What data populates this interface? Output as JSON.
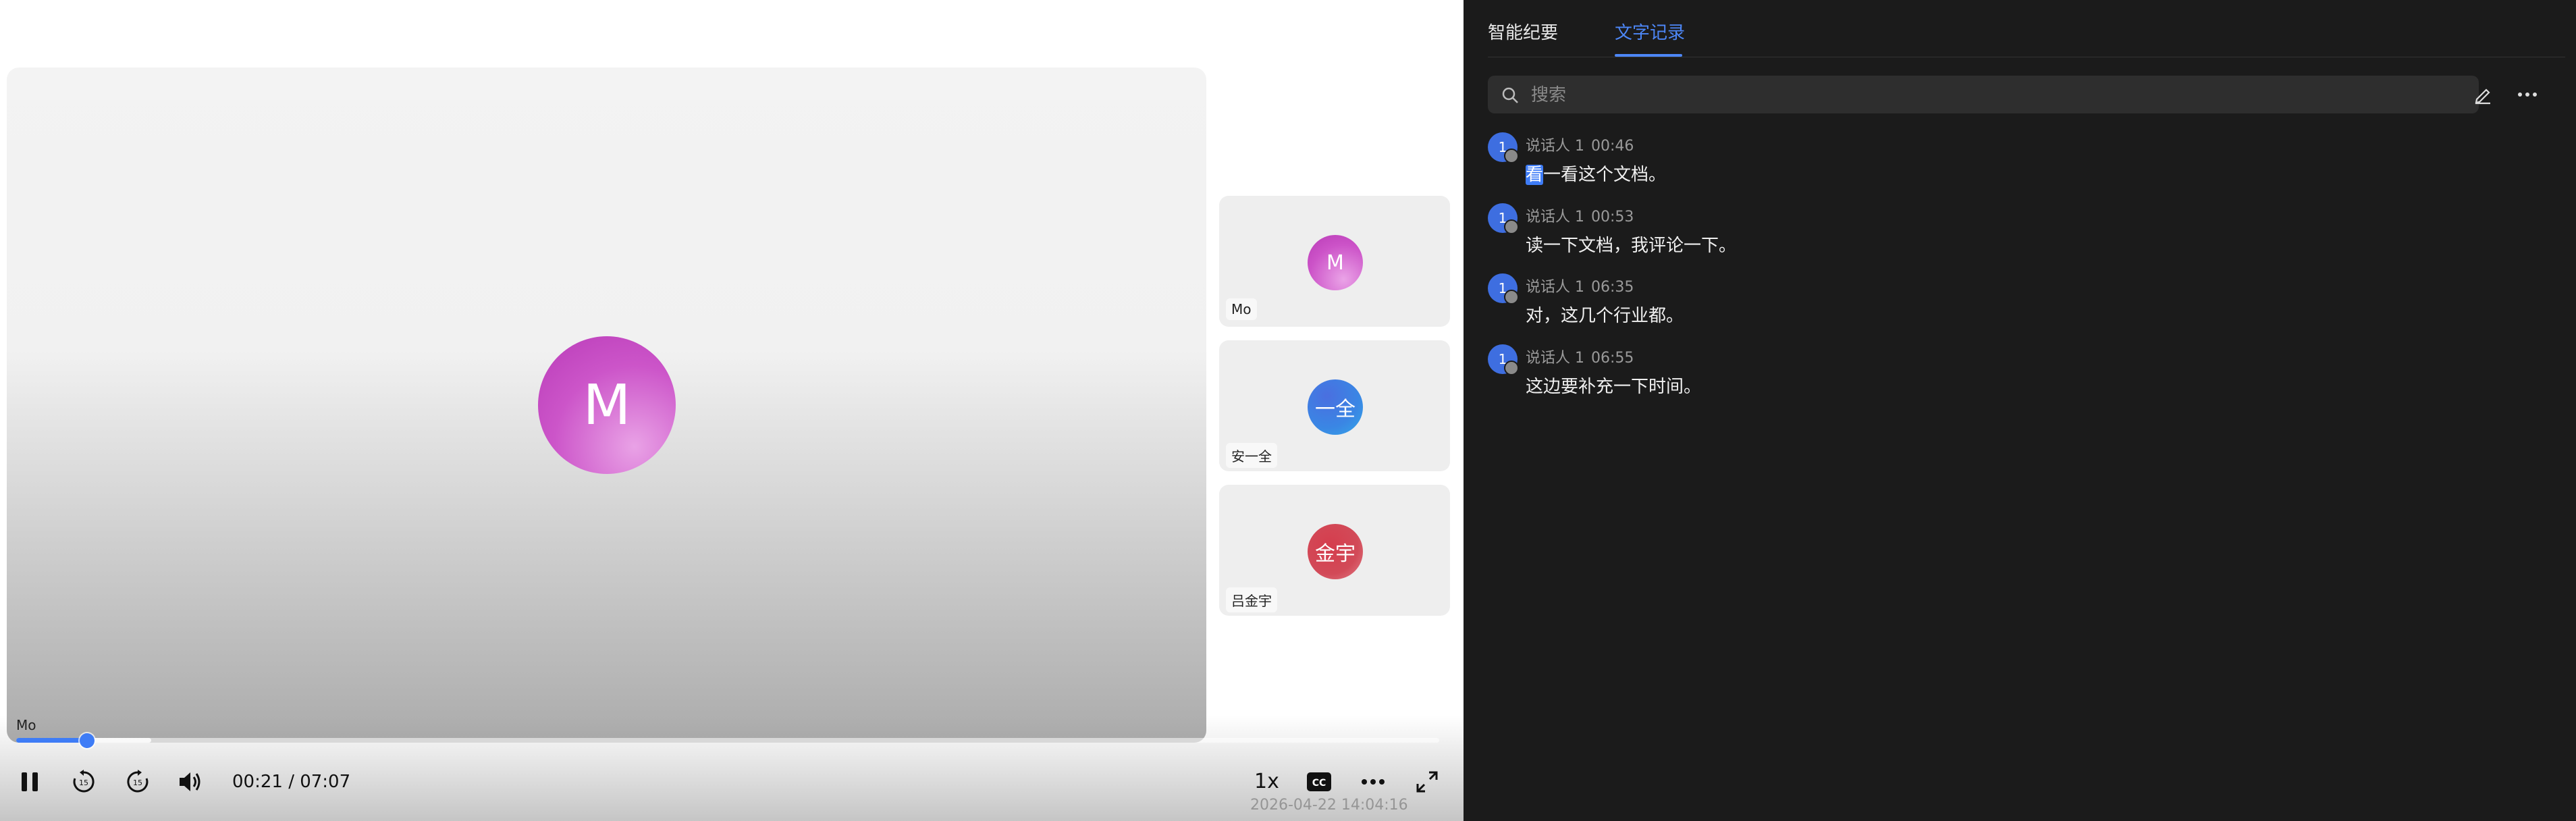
{
  "video": {
    "main_speaker": {
      "initial": "M",
      "label": "Mo"
    },
    "participants": [
      {
        "initials": "M",
        "name": "Mo"
      },
      {
        "initials": "一全",
        "name": "安一全"
      },
      {
        "initials": "金宇",
        "name": "吕金宇"
      }
    ],
    "progress_fraction": 0.05,
    "buffered_fraction": 0.095,
    "current_time": "00:21",
    "total_time": "07:07",
    "time_display": "00:21 / 07:07",
    "speed_label": "1x",
    "watermark": "2026-04-22 14:04:16"
  },
  "panel": {
    "tabs": [
      {
        "label": "智能纪要",
        "active": false
      },
      {
        "label": "文字记录",
        "active": true
      }
    ],
    "search_placeholder": "搜索",
    "entries": [
      {
        "avatar": "1",
        "speaker": "说话人 1",
        "time": "00:46",
        "highlight": "看",
        "text": "一看这个文档。"
      },
      {
        "avatar": "1",
        "speaker": "说话人 1",
        "time": "00:53",
        "highlight": "",
        "text": "读一下文档，我评论一下。"
      },
      {
        "avatar": "1",
        "speaker": "说话人 1",
        "time": "06:35",
        "highlight": "",
        "text": "对，这几个行业都。"
      },
      {
        "avatar": "1",
        "speaker": "说话人 1",
        "time": "06:55",
        "highlight": "",
        "text": "这边要补充一下时间。"
      }
    ],
    "accent_color": "#4d87f7"
  }
}
